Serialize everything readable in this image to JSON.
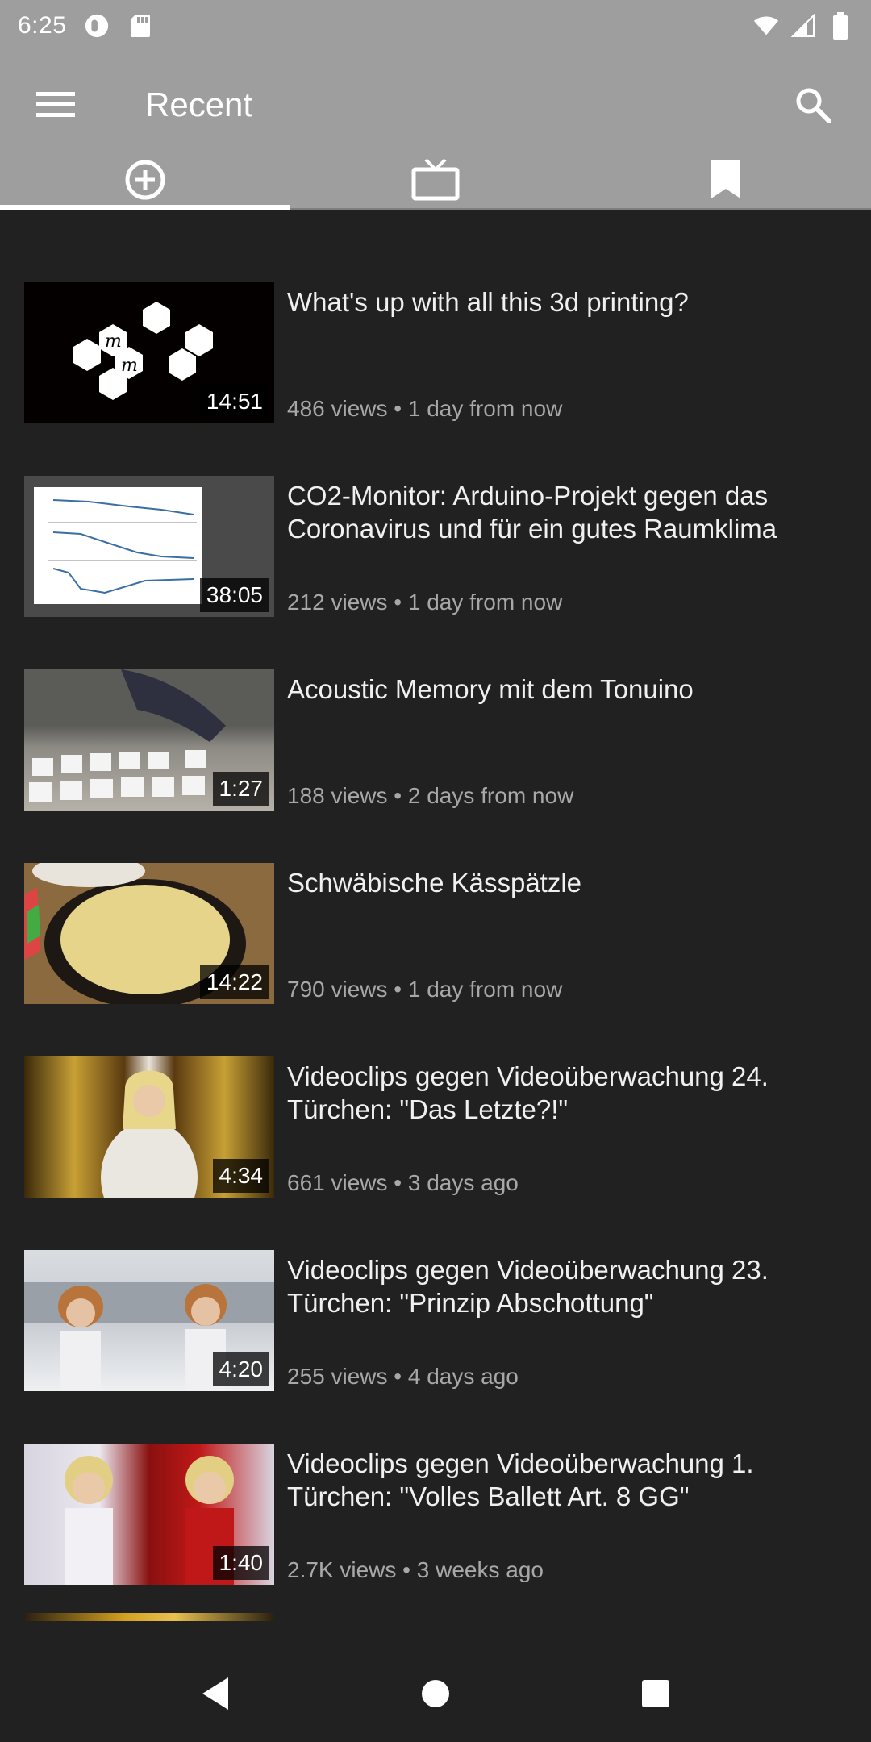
{
  "status_bar": {
    "time": "6:25",
    "icons": [
      "do-not-disturb-icon",
      "sd-card-icon",
      "wifi-icon",
      "signal-icon",
      "battery-icon"
    ]
  },
  "app_bar": {
    "title": "Recent",
    "menu_icon": "menu-icon",
    "search_icon": "search-icon"
  },
  "tabs": [
    {
      "icon": "add-circle-icon",
      "active": true
    },
    {
      "icon": "tv-icon",
      "active": false
    },
    {
      "icon": "bookmark-icon",
      "active": false
    }
  ],
  "videos": [
    {
      "title": "What's up with all this 3d printing?",
      "meta": "486 views • 1 day from now",
      "duration": "14:51"
    },
    {
      "title": "CO2-Monitor: Arduino-Projekt gegen das Coronavirus und für ein gutes Raumklima",
      "meta": "212 views • 1 day from now",
      "duration": "38:05"
    },
    {
      "title": "Acoustic Memory mit dem Tonuino",
      "meta": "188 views • 2 days from now",
      "duration": "1:27"
    },
    {
      "title": "Schwäbische Kässpätzle",
      "meta": "790 views • 1 day from now",
      "duration": "14:22"
    },
    {
      "title": "Videoclips gegen Videoüberwachung 24. Türchen: \"Das Letzte?!\"",
      "meta": "661 views • 3 days ago",
      "duration": "4:34"
    },
    {
      "title": "Videoclips gegen Videoüberwachung 23. Türchen: \"Prinzip Abschottung\"",
      "meta": "255 views • 4 days ago",
      "duration": "4:20"
    },
    {
      "title": "Videoclips gegen Videoüberwachung 1. Türchen: \"Volles Ballett Art. 8 GG\"",
      "meta": "2.7K views • 3 weeks ago",
      "duration": "1:40"
    }
  ],
  "nav_bar": {
    "icons": [
      "back-icon",
      "home-icon",
      "recents-icon"
    ]
  }
}
